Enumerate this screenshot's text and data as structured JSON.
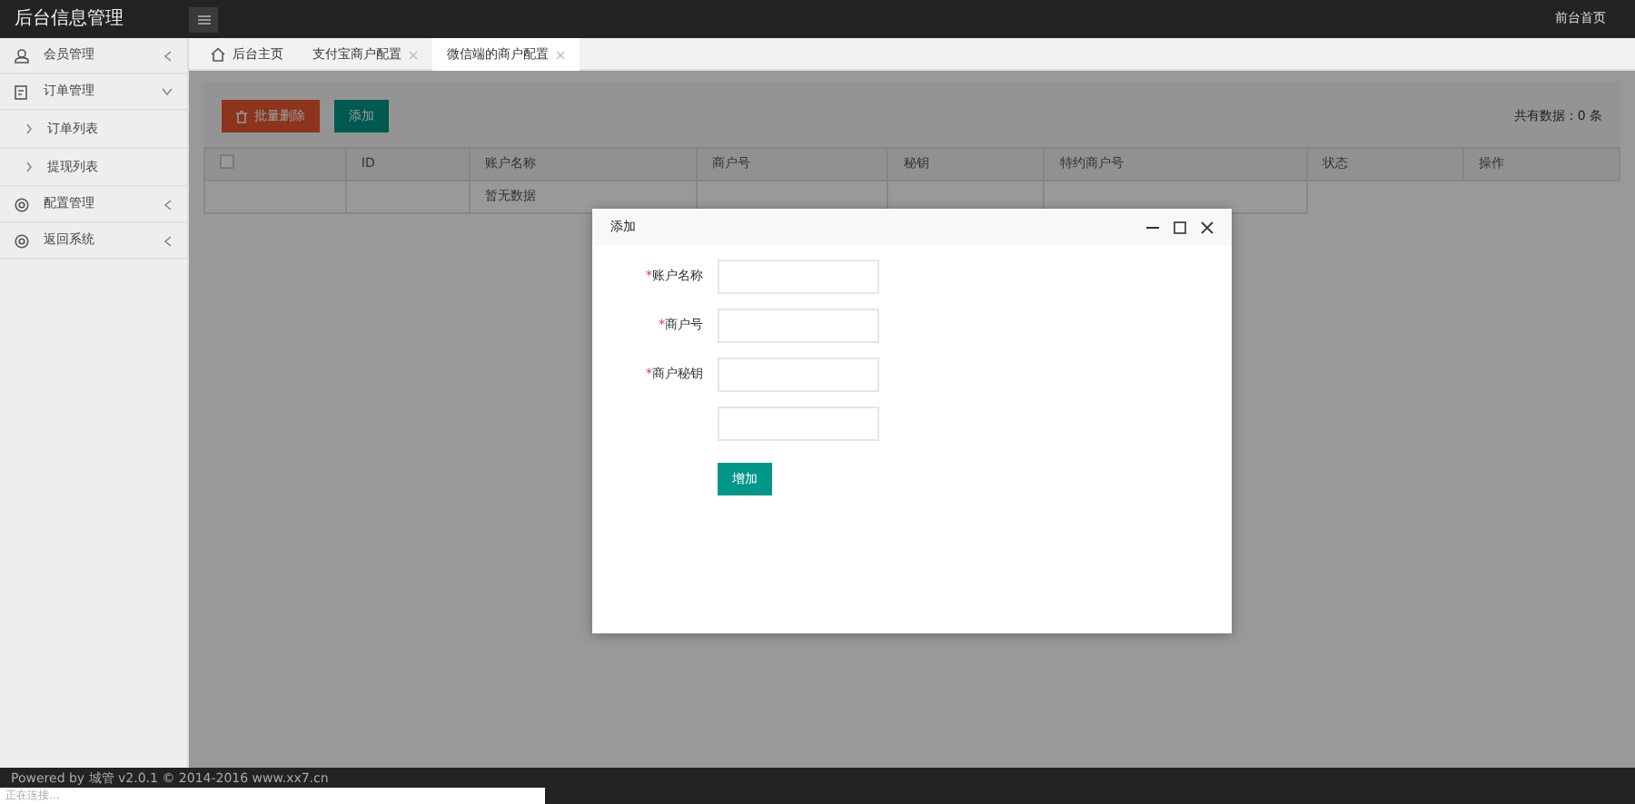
{
  "header": {
    "title": "后台信息管理",
    "right_link": "前台首页"
  },
  "sidebar": {
    "items": [
      {
        "label": "会员管理",
        "expanded": false
      },
      {
        "label": "订单管理",
        "expanded": true,
        "children": [
          {
            "label": "订单列表"
          },
          {
            "label": "提现列表"
          }
        ]
      },
      {
        "label": "配置管理",
        "expanded": false
      },
      {
        "label": "返回系统",
        "expanded": false
      }
    ]
  },
  "tabs": [
    {
      "label": "后台主页",
      "kind": "home",
      "selected": false
    },
    {
      "label": "支付宝商户配置",
      "kind": "page",
      "selected": false
    },
    {
      "label": "微信端的商户配置",
      "kind": "page",
      "selected": true
    }
  ],
  "toolbar": {
    "delete_button": "批量删除",
    "add_button": "添加",
    "total": "共有数据：0 条"
  },
  "table": {
    "select_all_checked": false,
    "columns": [
      "",
      "ID",
      "账户名称",
      "商户号",
      "秘钥",
      "特约商户号",
      "状态",
      "操作"
    ],
    "empty_text": "暂无数据"
  },
  "dialog": {
    "title": "添加",
    "fields": [
      {
        "kind": "text",
        "mark": "*",
        "label": "账户名称"
      },
      {
        "kind": "text",
        "mark": "*",
        "label": "商户号"
      },
      {
        "kind": "text",
        "mark": "*",
        "label": "商户秘钥"
      },
      {
        "kind": "text"
      }
    ],
    "submit": "增加"
  },
  "footer": "Powered by 城管 v2.0.1 © 2014-2016 www.xx7.cn",
  "status_bar": "正在连接..."
}
